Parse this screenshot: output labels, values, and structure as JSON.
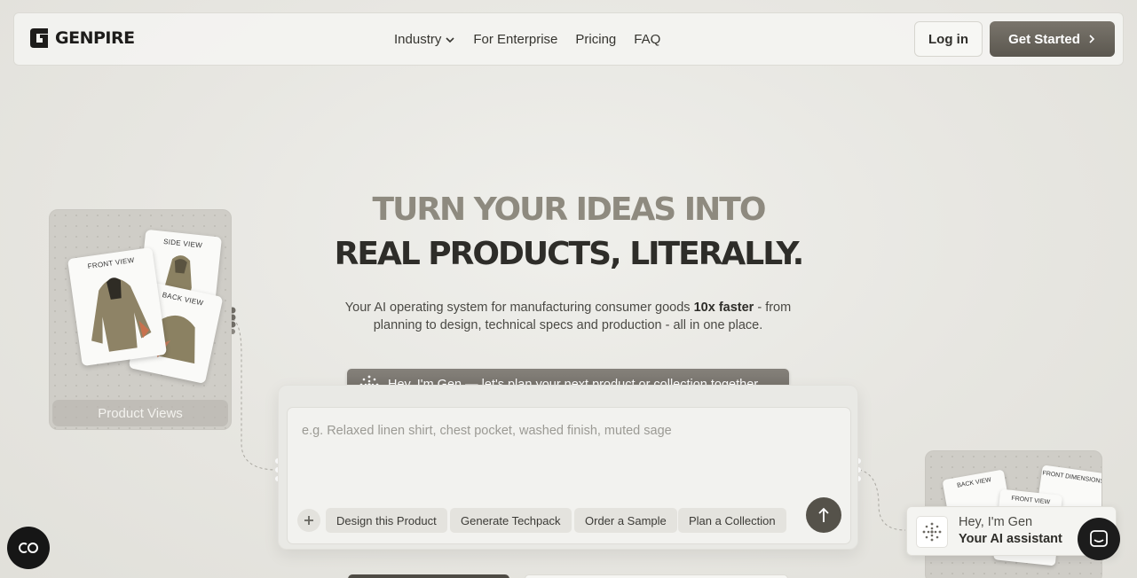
{
  "nav": {
    "logo_text": "GENPIRE",
    "links": [
      {
        "label": "Industry",
        "has_dropdown": true
      },
      {
        "label": "For Enterprise"
      },
      {
        "label": "Pricing"
      },
      {
        "label": "FAQ"
      }
    ],
    "login_label": "Log in",
    "get_started_label": "Get Started"
  },
  "hero": {
    "title_line1": "TURN YOUR IDEAS INTO",
    "title_line2": "REAL PRODUCTS, LITERALLY.",
    "subtitle_pre": "Your AI operating system for manufacturing consumer goods ",
    "subtitle_bold": "10x faster",
    "subtitle_post": " - from planning to design, technical specs and production - all in one place."
  },
  "gen_banner": "Hey, I'm Gen — let's plan your next product or collection together",
  "prompt": {
    "placeholder": "e.g. Relaxed linen shirt, chest pocket, washed finish, muted sage",
    "chips": [
      "Design this Product",
      "Generate Techpack",
      "Order a Sample",
      "Plan a Collection"
    ]
  },
  "left_card": {
    "label": "Product Views",
    "captions": [
      "FRONT VIEW",
      "SIDE VIEW",
      "BACK VIEW"
    ]
  },
  "right_card": {
    "captions": [
      "BACK VIEW",
      "FRONT DIMENSIONS",
      "FRONT VIEW"
    ]
  },
  "assistant": {
    "greeting": "Hey, I'm Gen",
    "role": "Your AI assistant"
  },
  "colors": {
    "accent": "#5b574f",
    "background": "#e7e6e1",
    "title_muted": "#8e8a7f"
  }
}
